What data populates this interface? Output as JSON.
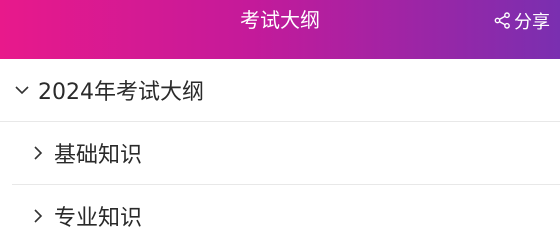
{
  "header": {
    "title": "考试大纲",
    "share_label": "分享",
    "gradient_colors": [
      "#e8198b",
      "#7a2fb0"
    ]
  },
  "outline": {
    "section": {
      "label": "2024年考试大纲",
      "expanded": true,
      "icon": "chevron-down-icon"
    },
    "items": [
      {
        "label": "基础知识",
        "icon": "chevron-right-icon"
      },
      {
        "label": "专业知识",
        "icon": "chevron-right-icon"
      }
    ]
  }
}
